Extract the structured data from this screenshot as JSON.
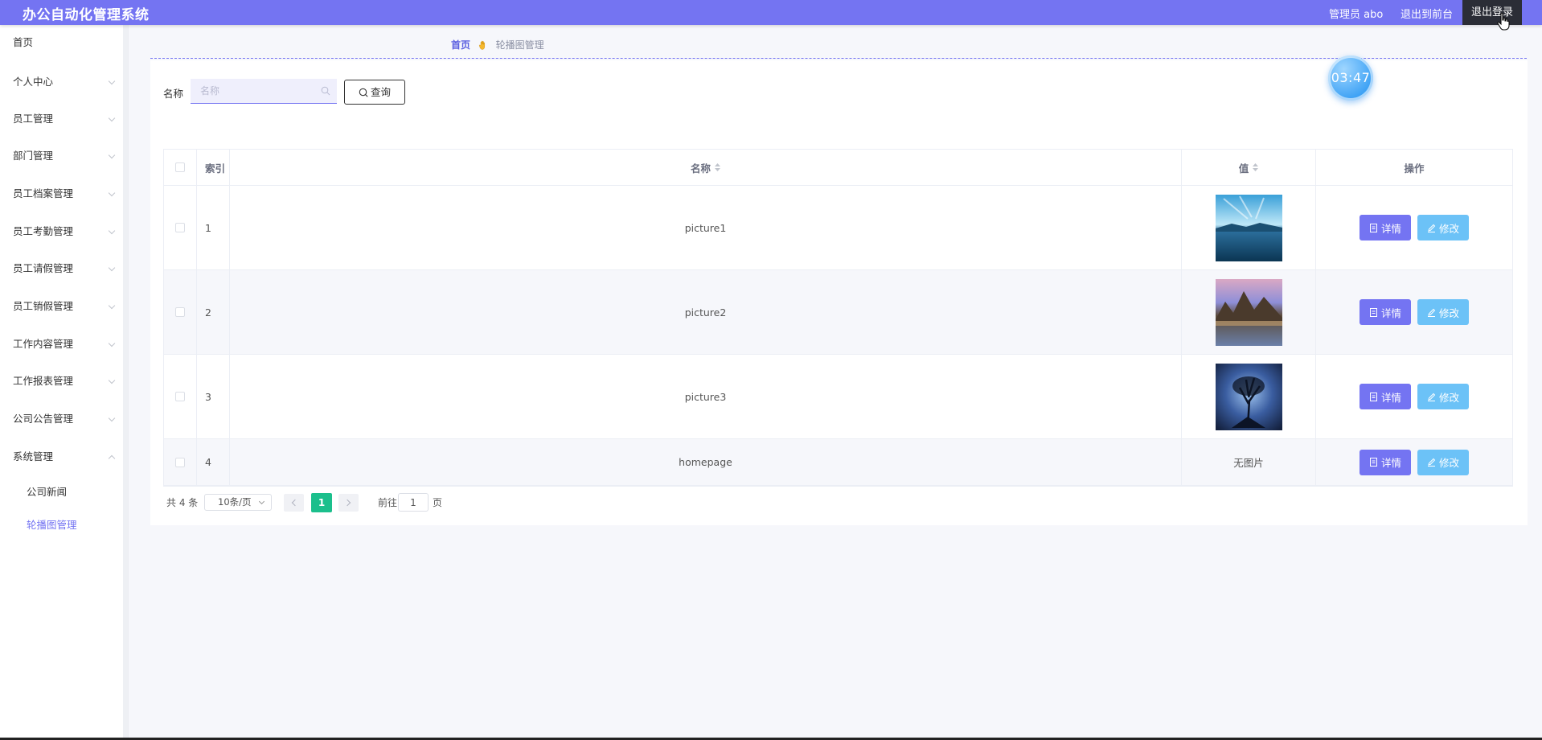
{
  "header": {
    "title": "办公自动化管理系统",
    "user": "管理员 abo",
    "to_front": "退出到前台",
    "logout": "退出登录",
    "color": "#7474f2"
  },
  "sidebar": {
    "items": [
      {
        "label": "首页"
      },
      {
        "label": "个人中心"
      },
      {
        "label": "员工管理"
      },
      {
        "label": "部门管理"
      },
      {
        "label": "员工档案管理"
      },
      {
        "label": "员工考勤管理"
      },
      {
        "label": "员工请假管理"
      },
      {
        "label": "员工销假管理"
      },
      {
        "label": "工作内容管理"
      },
      {
        "label": "工作报表管理"
      },
      {
        "label": "公司公告管理"
      },
      {
        "label": "系统管理"
      }
    ],
    "sub_items": [
      {
        "label": "公司新闻"
      },
      {
        "label": "轮播图管理",
        "active": true
      }
    ]
  },
  "breadcrumb": {
    "home": "首页",
    "current": "轮播图管理"
  },
  "clock": "03:47",
  "search": {
    "label": "名称",
    "placeholder": "名称",
    "value": "",
    "button": "查询"
  },
  "table": {
    "headers": {
      "index": "索引",
      "name": "名称",
      "value": "值",
      "ops": "操作"
    },
    "rows": [
      {
        "index": "1",
        "name": "picture1",
        "value": "",
        "thumb": "image-thumbnail"
      },
      {
        "index": "2",
        "name": "picture2",
        "value": "",
        "thumb": "image-thumbnail"
      },
      {
        "index": "3",
        "name": "picture3",
        "value": "",
        "thumb": "image-thumbnail"
      },
      {
        "index": "4",
        "name": "homepage",
        "value": "无图片",
        "thumb": ""
      }
    ],
    "detail_btn": "详情",
    "edit_btn": "修改"
  },
  "pagination": {
    "total": "共 4 条",
    "page_size": "10条/页",
    "current": "1",
    "goto_label": "前往",
    "goto_value": "1",
    "page_label": "页"
  },
  "colors": {
    "accent": "#7474f2",
    "edit": "#6cc2f7",
    "active_page": "#1bbf8c"
  }
}
